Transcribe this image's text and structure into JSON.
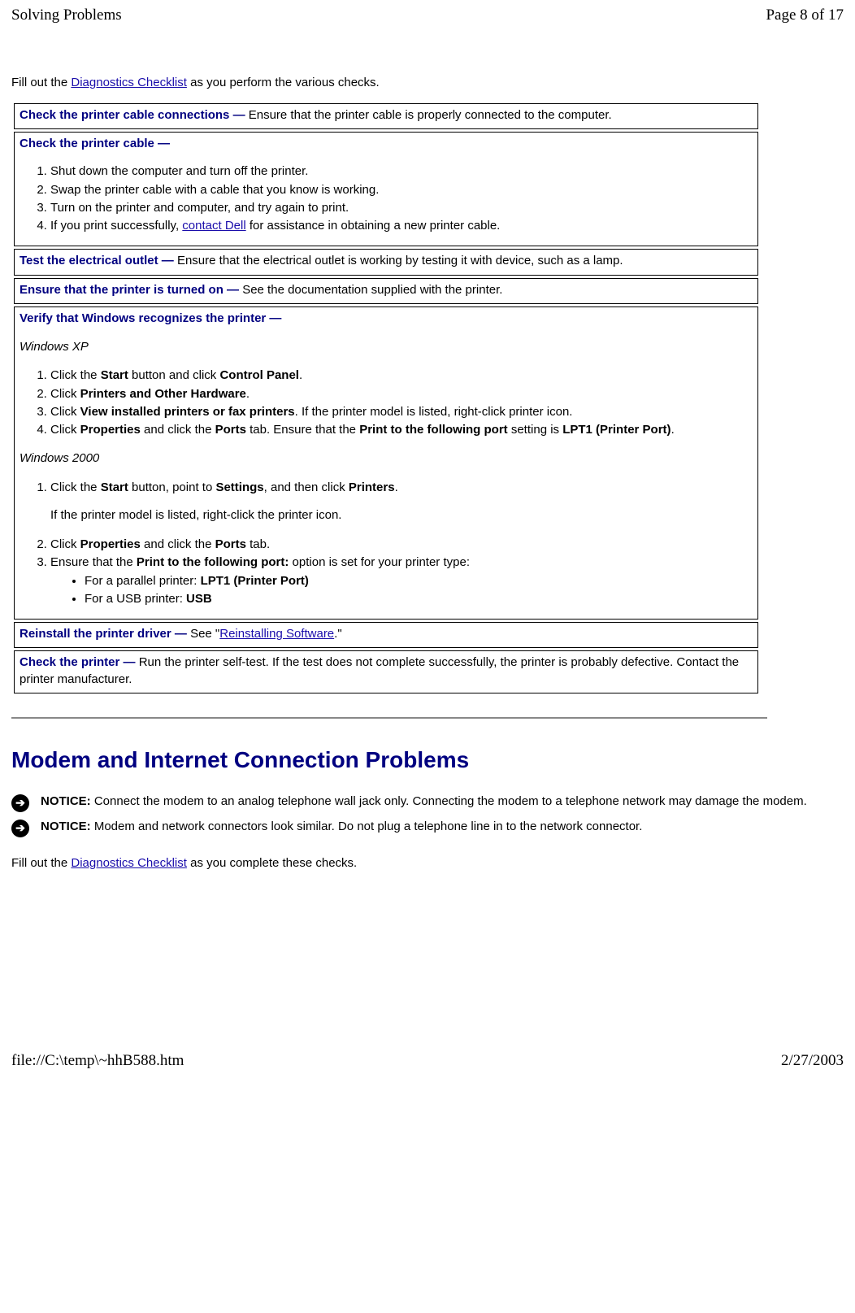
{
  "header": {
    "title": "Solving Problems",
    "page_indicator": "Page 8 of 17"
  },
  "intro": {
    "prefix": "Fill out the ",
    "link": "Diagnostics Checklist",
    "suffix": " as you perform the various checks."
  },
  "table": {
    "row1": {
      "title": "Check the printer cable connections — ",
      "text": "Ensure that the printer cable is properly connected to the computer."
    },
    "row2": {
      "title": "Check the printer cable —",
      "li1": "Shut down the computer and turn off the printer.",
      "li2": "Swap the printer cable with a cable that you know is working.",
      "li3": "Turn on the printer and computer, and try again to print.",
      "li4_pre": "If you print successfully, ",
      "li4_link": "contact Dell",
      "li4_post": " for assistance in obtaining a new printer cable."
    },
    "row3": {
      "title": "Test the electrical outlet — ",
      "text": "Ensure that the electrical outlet is working by testing it with device, such as a lamp."
    },
    "row4": {
      "title": "Ensure that the printer is turned on — ",
      "text": "See the documentation supplied with the printer."
    },
    "row5": {
      "title": "Verify that Windows recognizes the printer —",
      "os1": "Windows XP",
      "xp1_pre": "Click the ",
      "xp1_b1": "Start",
      "xp1_mid": " button and click ",
      "xp1_b2": "Control Panel",
      "xp1_post": ".",
      "xp2_pre": "Click ",
      "xp2_b": "Printers and Other Hardware",
      "xp2_post": ".",
      "xp3_pre": "Click ",
      "xp3_b": "View installed printers or fax printers",
      "xp3_post": ". If the printer model is listed, right-click printer icon.",
      "xp4_pre": "Click ",
      "xp4_b1": "Properties",
      "xp4_mid1": " and click the ",
      "xp4_b2": "Ports",
      "xp4_mid2": " tab. Ensure that the ",
      "xp4_b3": "Print to the following port",
      "xp4_mid3": " setting is ",
      "xp4_b4": "LPT1 (Printer Port)",
      "xp4_post": ".",
      "os2": "Windows 2000",
      "w2k1_pre": "Click the ",
      "w2k1_b1": "Start",
      "w2k1_mid1": " button, point to ",
      "w2k1_b2": "Settings",
      "w2k1_mid2": ", and then click ",
      "w2k1_b3": "Printers",
      "w2k1_post": ".",
      "w2k1_sub": "If the printer model is listed, right-click the printer icon.",
      "w2k2_pre": "Click ",
      "w2k2_b1": "Properties",
      "w2k2_mid": " and click the ",
      "w2k2_b2": "Ports",
      "w2k2_post": " tab.",
      "w2k3_pre": "Ensure that the ",
      "w2k3_b": "Print to the following port:",
      "w2k3_post": " option is set for your printer type:",
      "w2k3_bul1_pre": "For a parallel printer: ",
      "w2k3_bul1_b": "LPT1 (Printer Port)",
      "w2k3_bul2_pre": "For a USB printer: ",
      "w2k3_bul2_b": "USB"
    },
    "row6": {
      "title": "Reinstall the printer driver — ",
      "text_pre": "See \"",
      "link": "Reinstalling Software",
      "text_post": ".\""
    },
    "row7": {
      "title": "Check the printer — ",
      "text": "Run the printer self-test. If the test does not complete successfully, the printer is probably defective. Contact the printer manufacturer."
    }
  },
  "section2": {
    "heading": "Modem and Internet Connection Problems",
    "notice1": {
      "label": "NOTICE:",
      "text": " Connect the modem to an analog telephone wall jack only. Connecting the modem to a telephone network may damage the modem."
    },
    "notice2": {
      "label": "NOTICE:",
      "text": " Modem and network connectors look similar. Do not plug a telephone line in to the network connector."
    },
    "intro_prefix": "Fill out the ",
    "intro_link": "Diagnostics Checklist",
    "intro_suffix": " as you complete these checks."
  },
  "footer": {
    "path": "file://C:\\temp\\~hhB588.htm",
    "date": "2/27/2003"
  }
}
